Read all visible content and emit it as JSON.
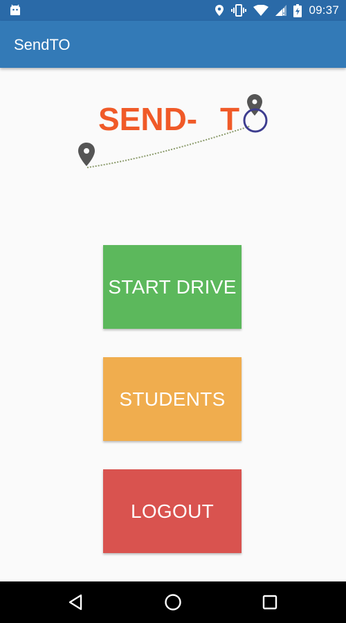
{
  "status_bar": {
    "time": "09:37",
    "icons": [
      "android-notification-icon",
      "location-icon",
      "vibrate-icon",
      "wifi-icon",
      "signal-icon",
      "battery-icon"
    ]
  },
  "app_bar": {
    "title": "SendTO"
  },
  "logo": {
    "text_send": "SEND-",
    "text_t": "T",
    "brand_color": "#f05a28",
    "accent_color": "#3d3d8f"
  },
  "buttons": {
    "start_drive": "START DRIVE",
    "students": "STUDENTS",
    "logout": "LOGOUT"
  },
  "colors": {
    "status_bar": "#2a6aa8",
    "app_bar": "#337ab7",
    "start_drive": "#5cb85c",
    "students": "#f0ad4e",
    "logout": "#d9534f",
    "background": "#fafafa",
    "nav_bar": "#000000"
  },
  "nav_bar": {
    "icons": [
      "back-icon",
      "home-icon",
      "recents-icon"
    ]
  }
}
